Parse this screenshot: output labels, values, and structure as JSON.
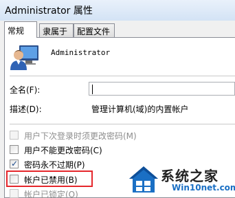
{
  "window": {
    "title": "Administrator 属性"
  },
  "tabs": [
    {
      "label": "常规",
      "active": true
    },
    {
      "label": "隶属于",
      "active": false
    },
    {
      "label": "配置文件",
      "active": false
    }
  ],
  "user": {
    "name": "Administrator",
    "icon": "user-avatar-icon"
  },
  "fields": {
    "fullname": {
      "label": "全名(F):",
      "value": ""
    },
    "description": {
      "label": "描述(D):",
      "value": "管理计算机(域)的内置帐户"
    }
  },
  "checkboxes": [
    {
      "label": "用户下次登录时须更改密码(M)",
      "checked": false,
      "enabled": false
    },
    {
      "label": "用户不能更改密码(C)",
      "checked": false,
      "enabled": true
    },
    {
      "label": "密码永不过期(P)",
      "checked": true,
      "enabled": true
    },
    {
      "label": "帐户已禁用(B)",
      "checked": false,
      "enabled": true
    },
    {
      "label": "帐户已锁定(O)",
      "checked": false,
      "enabled": false
    }
  ],
  "watermark": {
    "brand": "系统之家",
    "url": "Win10net.com"
  },
  "colors": {
    "highlight": "#e5262b",
    "titlebar": "#d3e3f5",
    "watermark_blue": "#1a6fc4"
  }
}
